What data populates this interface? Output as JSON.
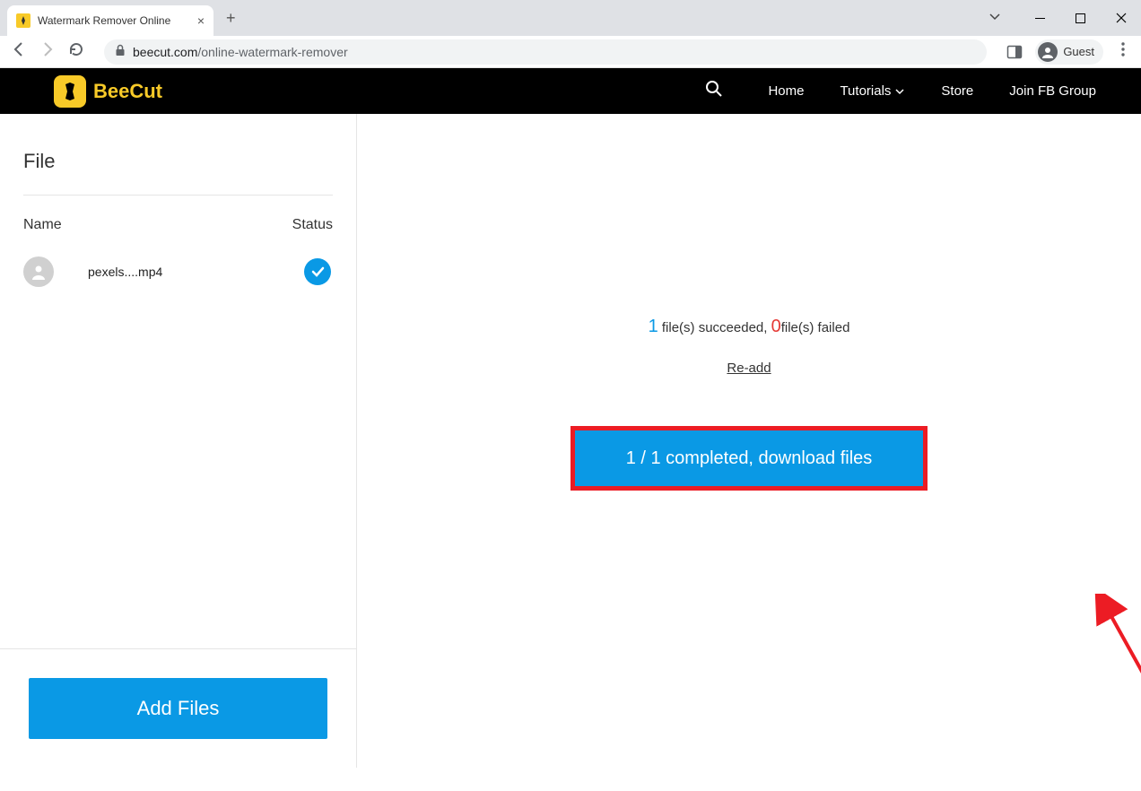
{
  "browser": {
    "tab_title": "Watermark Remover Online",
    "url_domain": "beecut.com",
    "url_path": "/online-watermark-remover",
    "guest_label": "Guest"
  },
  "header": {
    "brand": "BeeCut",
    "nav": {
      "home": "Home",
      "tutorials": "Tutorials",
      "store": "Store",
      "fbgroup": "Join FB Group"
    }
  },
  "sidebar": {
    "heading": "File",
    "col_name": "Name",
    "col_status": "Status",
    "files": [
      {
        "name": "pexels....mp4"
      }
    ],
    "add_button": "Add Files"
  },
  "content": {
    "success_count": "1",
    "success_suffix": " file(s) succeeded, ",
    "fail_count": "0",
    "fail_suffix": "file(s) failed",
    "readd_label": "Re-add",
    "download_label": "1 / 1 completed, download files"
  }
}
